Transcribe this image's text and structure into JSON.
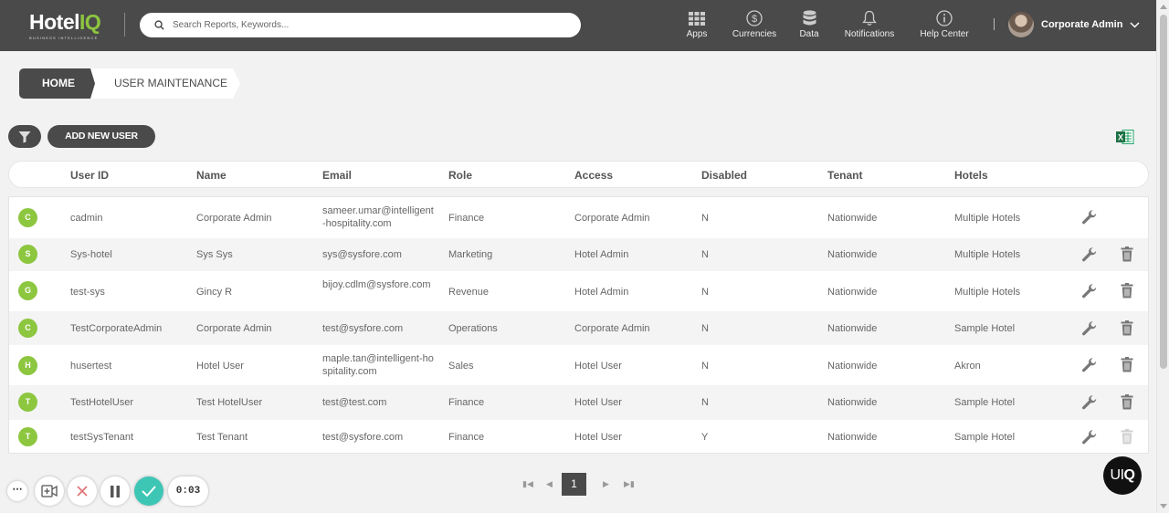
{
  "header": {
    "logo_main": "HotelIQ",
    "logo_sub": "BUSINESS INTELLIGENCE",
    "search_placeholder": "Search Reports, Keywords...",
    "nav": [
      {
        "label": "Apps",
        "icon": "apps-grid-icon"
      },
      {
        "label": "Currencies",
        "icon": "dollar-circle-icon"
      },
      {
        "label": "Data",
        "icon": "database-icon"
      },
      {
        "label": "Notifications",
        "icon": "bell-icon"
      },
      {
        "label": "Help Center",
        "icon": "info-circle-icon"
      }
    ],
    "user_name": "Corporate Admin"
  },
  "breadcrumb": {
    "home": "HOME",
    "current": "USER MAINTENANCE"
  },
  "toolbar": {
    "add_user_label": "ADD NEW USER",
    "filter_icon": "filter-icon",
    "export_icon": "excel-icon"
  },
  "table": {
    "columns": [
      "User ID",
      "Name",
      "Email",
      "Role",
      "Access",
      "Disabled",
      "Tenant",
      "Hotels"
    ],
    "rows": [
      {
        "initial": "C",
        "user_id": "cadmin",
        "name": "Corporate Admin",
        "email": "sameer.umar@intelligent-hospitality.com",
        "role": "Finance",
        "access": "Corporate Admin",
        "disabled": "N",
        "tenant": "Nationwide",
        "hotels": "Multiple Hotels",
        "can_delete": false
      },
      {
        "initial": "S",
        "user_id": "Sys-hotel",
        "name": "Sys Sys",
        "email": "sys@sysfore.com",
        "role": "Marketing",
        "access": "Hotel Admin",
        "disabled": "N",
        "tenant": "Nationwide",
        "hotels": "Multiple Hotels",
        "can_delete": true
      },
      {
        "initial": "G",
        "user_id": "test-sys",
        "name": "Gincy R",
        "email": "bijoy.cdlm@sysfore.com",
        "role": "Revenue",
        "access": "Hotel Admin",
        "disabled": "N",
        "tenant": "Nationwide",
        "hotels": "Multiple Hotels",
        "can_delete": true
      },
      {
        "initial": "C",
        "user_id": "TestCorporateAdmin",
        "name": "Corporate Admin",
        "email": "test@sysfore.com",
        "role": "Operations",
        "access": "Corporate Admin",
        "disabled": "N",
        "tenant": "Nationwide",
        "hotels": "Sample Hotel",
        "can_delete": true
      },
      {
        "initial": "H",
        "user_id": "husertest",
        "name": "Hotel User",
        "email": "maple.tan@intelligent-hospitality.com",
        "role": "Sales",
        "access": "Hotel User",
        "disabled": "N",
        "tenant": "Nationwide",
        "hotels": "Akron",
        "can_delete": true
      },
      {
        "initial": "T",
        "user_id": "TestHotelUser",
        "name": "Test HotelUser",
        "email": "test@test.com",
        "role": "Finance",
        "access": "Hotel User",
        "disabled": "N",
        "tenant": "Nationwide",
        "hotels": "Sample Hotel",
        "can_delete": true
      },
      {
        "initial": "T",
        "user_id": "testSysTenant",
        "name": "Test Tenant",
        "email": "test@sysfore.com",
        "role": "Finance",
        "access": "Hotel User",
        "disabled": "Y",
        "tenant": "Nationwide",
        "hotels": "Sample Hotel",
        "can_delete": "disabled"
      }
    ]
  },
  "pagination": {
    "current_page": "1"
  },
  "recorder": {
    "timer": "0:03"
  },
  "uiq_badge": {
    "part1": "UI",
    "part2": "Q"
  },
  "colors": {
    "header_bg": "#4a4a4a",
    "accent_green": "#8dc63f",
    "recorder_check": "#3ec6b5"
  }
}
